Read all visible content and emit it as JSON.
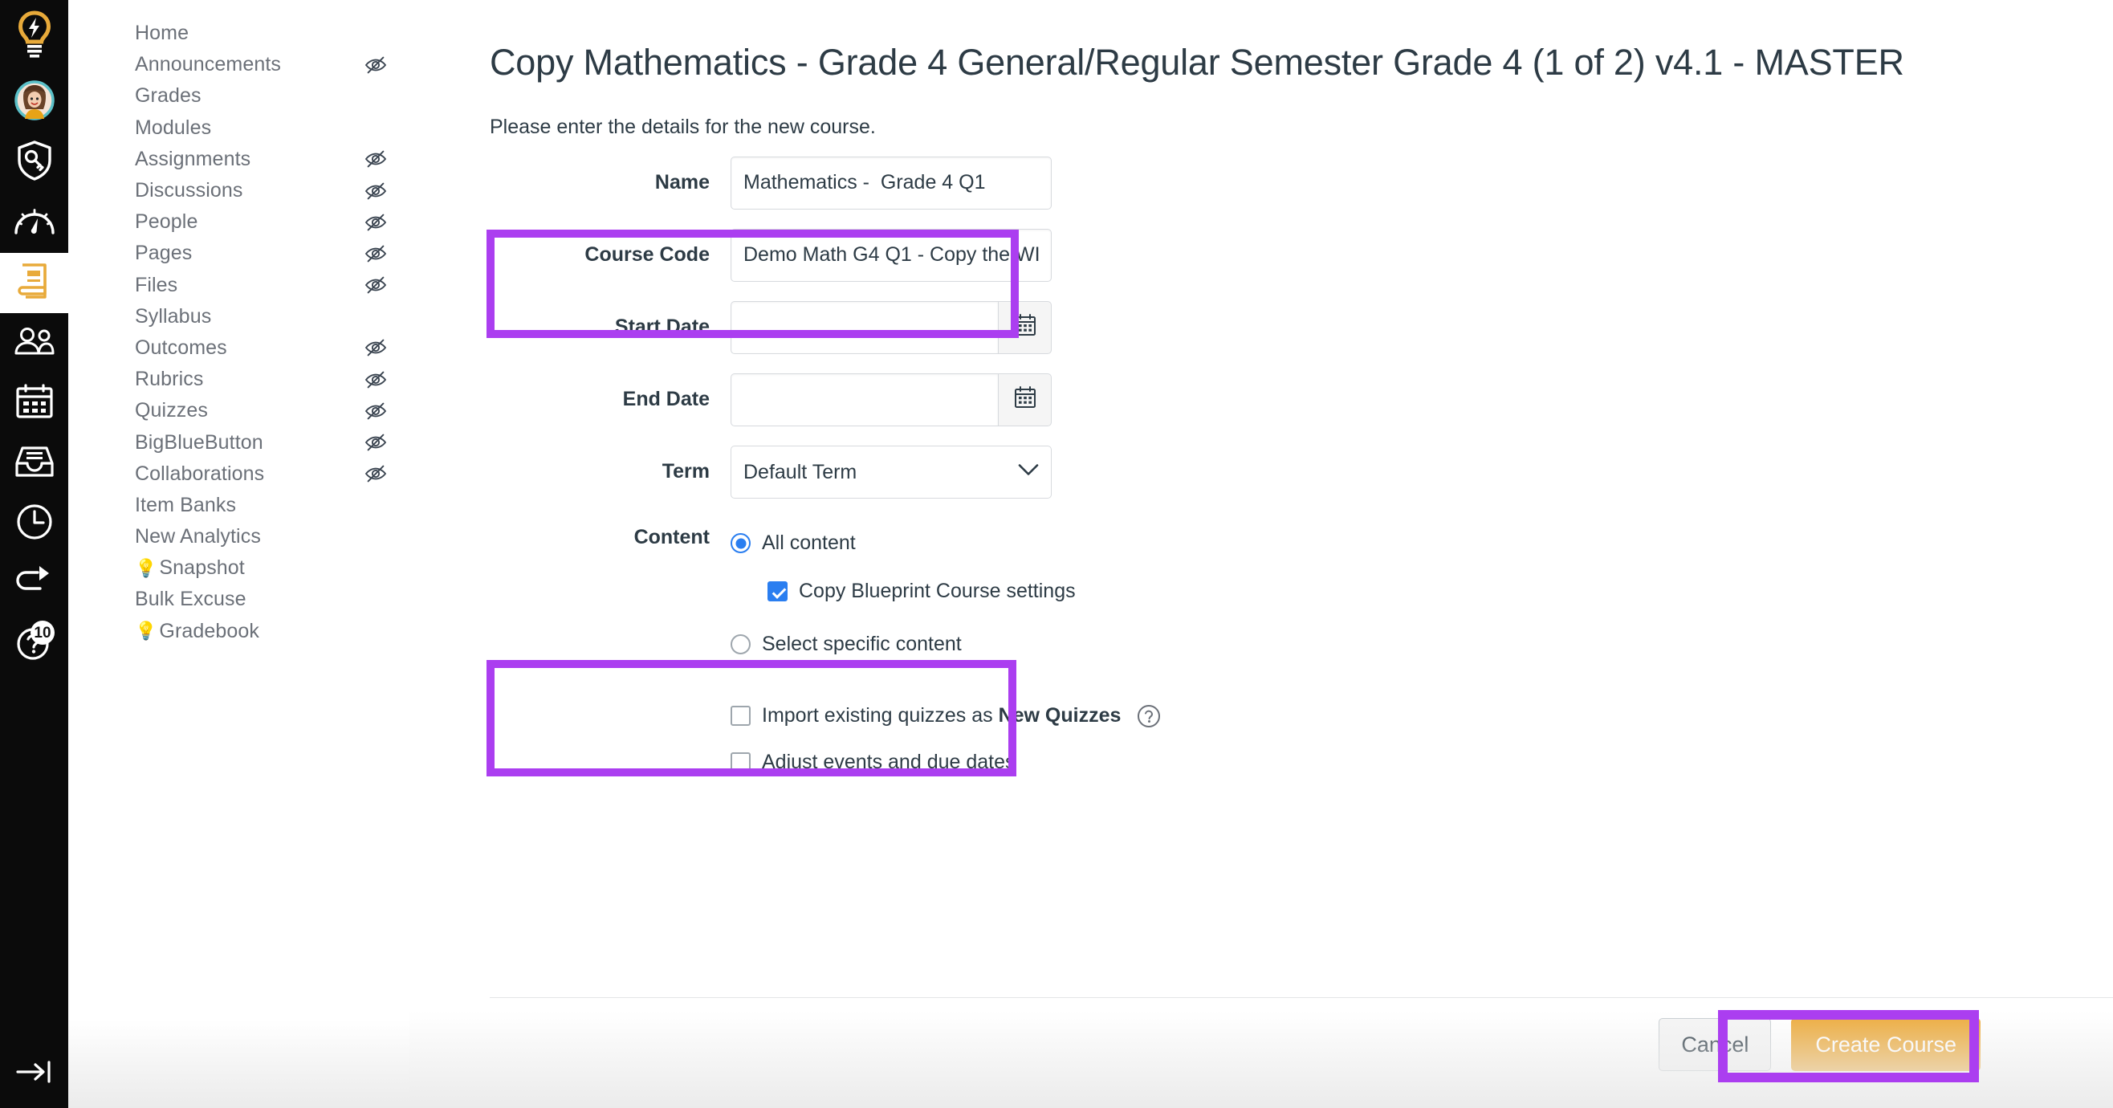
{
  "global_nav": {
    "items": [
      {
        "name": "logo",
        "icon": "lightbulb-logo-icon",
        "label": "Dashboard Home Logo"
      },
      {
        "name": "account",
        "icon": "avatar-icon",
        "label": "Account"
      },
      {
        "name": "admin",
        "icon": "shield-key-icon",
        "label": "Admin"
      },
      {
        "name": "dashboard",
        "icon": "gauge-icon",
        "label": "Dashboard"
      },
      {
        "name": "courses",
        "icon": "book-icon",
        "label": "Courses",
        "active": true
      },
      {
        "name": "groups",
        "icon": "people-icon",
        "label": "Groups"
      },
      {
        "name": "calendar",
        "icon": "calendar-icon",
        "label": "Calendar"
      },
      {
        "name": "inbox",
        "icon": "inbox-icon",
        "label": "Inbox"
      },
      {
        "name": "history",
        "icon": "clock-icon",
        "label": "History"
      },
      {
        "name": "commons",
        "icon": "arrow-loop-icon",
        "label": "Commons"
      },
      {
        "name": "help",
        "icon": "help-circle-icon",
        "label": "Help",
        "badge": "10"
      }
    ],
    "collapse": {
      "icon": "arrow-to-line-icon",
      "label": "Expand navigation"
    }
  },
  "course_nav": {
    "items": [
      {
        "label": "Home",
        "hidden": false,
        "bulb": false
      },
      {
        "label": "Announcements",
        "hidden": true,
        "bulb": false
      },
      {
        "label": "Grades",
        "hidden": false,
        "bulb": false
      },
      {
        "label": "Modules",
        "hidden": false,
        "bulb": false
      },
      {
        "label": "Assignments",
        "hidden": true,
        "bulb": false
      },
      {
        "label": "Discussions",
        "hidden": true,
        "bulb": false
      },
      {
        "label": "People",
        "hidden": true,
        "bulb": false
      },
      {
        "label": "Pages",
        "hidden": true,
        "bulb": false
      },
      {
        "label": "Files",
        "hidden": true,
        "bulb": false
      },
      {
        "label": "Syllabus",
        "hidden": false,
        "bulb": false
      },
      {
        "label": "Outcomes",
        "hidden": true,
        "bulb": false
      },
      {
        "label": "Rubrics",
        "hidden": true,
        "bulb": false
      },
      {
        "label": "Quizzes",
        "hidden": true,
        "bulb": false
      },
      {
        "label": "BigBlueButton",
        "hidden": true,
        "bulb": false
      },
      {
        "label": "Collaborations",
        "hidden": true,
        "bulb": false
      },
      {
        "label": "Item Banks",
        "hidden": false,
        "bulb": false
      },
      {
        "label": "New Analytics",
        "hidden": false,
        "bulb": false
      },
      {
        "label": "Snapshot",
        "hidden": false,
        "bulb": true
      },
      {
        "label": "Bulk Excuse",
        "hidden": false,
        "bulb": false
      },
      {
        "label": "Gradebook",
        "hidden": false,
        "bulb": true
      }
    ],
    "hidden_icon": "eye-slash-icon",
    "bulb_glyph": "💡"
  },
  "page": {
    "title": "Copy Mathematics - Grade 4 General/Regular Semester Grade 4 (1 of 2) v4.1 - MASTER",
    "subtitle": "Please enter the details for the new course."
  },
  "form": {
    "name": {
      "label": "Name",
      "value": "Mathematics -  Grade 4 Q1",
      "placeholder": ""
    },
    "course_code": {
      "label": "Course Code",
      "value": "Demo Math G4 Q1 - Copy the WI",
      "placeholder": ""
    },
    "start_date": {
      "label": "Start Date",
      "value": "",
      "placeholder": "",
      "button_icon": "calendar-icon"
    },
    "end_date": {
      "label": "End Date",
      "value": "",
      "placeholder": "",
      "button_icon": "calendar-icon"
    },
    "term": {
      "label": "Term",
      "selected": "Default Term",
      "options": [
        "Default Term"
      ],
      "chevron_icon": "chevron-down-icon"
    },
    "content": {
      "label": "Content",
      "all_content": {
        "label": "All content",
        "selected": true
      },
      "copy_blueprint": {
        "label": "Copy Blueprint Course settings",
        "checked": true
      },
      "select_specific": {
        "label": "Select specific content",
        "selected": false
      }
    },
    "import_quizzes": {
      "checked": false,
      "text_prefix": "Import existing quizzes as ",
      "text_bold": "New Quizzes",
      "help_icon": "help-circle-icon"
    },
    "adjust_dates": {
      "checked": false,
      "label": "Adjust events and due dates"
    }
  },
  "footer": {
    "cancel_label": "Cancel",
    "create_label": "Create Course"
  },
  "colors": {
    "highlight_purple": "#ab3ef0",
    "create_button": "#edab3c",
    "accent_blue": "#2a7ef0",
    "logo_gold": "#e8aa3a",
    "avatar_ring": "#5bc0c8",
    "nav_text": "#6b7078"
  },
  "annotations": [
    {
      "name": "name-and-code-highlight",
      "target": "Name / Course Code fields"
    },
    {
      "name": "content-highlight",
      "target": "All content + Copy Blueprint Course settings"
    },
    {
      "name": "create-course-highlight",
      "target": "Create Course button"
    }
  ]
}
